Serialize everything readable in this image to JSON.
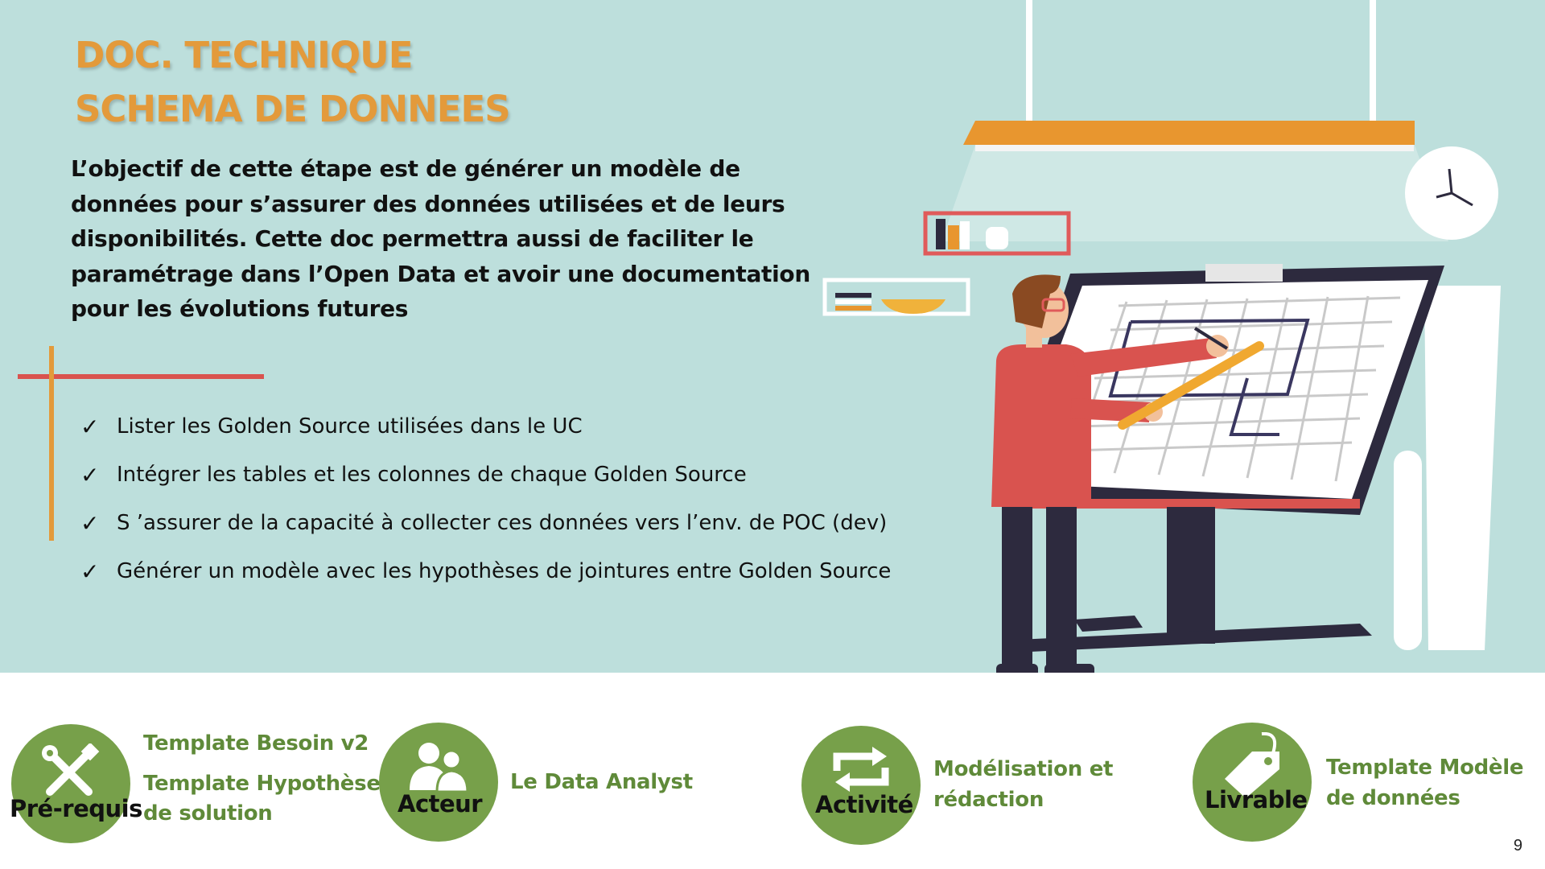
{
  "slide": {
    "title_line1": "DOC. TECHNIQUE",
    "title_line2": "SCHEMA DE DONNEES",
    "intro_lines": [
      "L’objectif de cette étape est de générer un modèle de",
      "données pour s’assurer des données utilisées et de leurs",
      "disponibilités. Cette doc permettra aussi de  faciliter le",
      "paramétrage dans l’Open Data et avoir une documentation",
      "pour les évolutions futures"
    ],
    "bullets": [
      "Lister les Golden Source utilisées dans le UC",
      "Intégrer les tables et les colonnes de chaque Golden Source",
      "S ’assurer de la capacité à collecter ces données vers l’env. de POC (dev)",
      "Générer un modèle avec les hypothèses de jointures entre Golden Source"
    ],
    "check_glyph": "✓",
    "page_number": "9"
  },
  "footer": {
    "prerequis": {
      "label": "Pré-requis",
      "icon": "tools-icon",
      "items": [
        "Template Besoin v2",
        "Template Hypothèses",
        "de solution"
      ]
    },
    "acteur": {
      "label": "Acteur",
      "icon": "users-icon",
      "items": [
        "Le Data Analyst"
      ]
    },
    "activite": {
      "label": "Activité",
      "icon": "refresh-icon",
      "items": [
        "Modélisation et",
        "rédaction"
      ]
    },
    "livrable": {
      "label": "Livrable",
      "icon": "tag-icon",
      "items": [
        "Template Modèle",
        "de données"
      ]
    }
  },
  "colors": {
    "background_top": "#bddfdc",
    "title": "#e39a3b",
    "accent_green": "#77a04a",
    "text_green": "#5f8a39",
    "cross_red": "#d9534f",
    "cross_orange": "#e39a3b"
  }
}
